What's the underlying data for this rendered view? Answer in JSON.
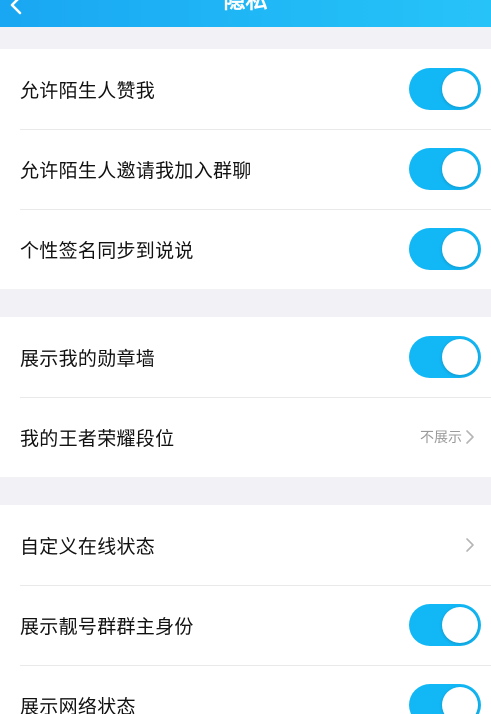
{
  "header": {
    "title": "隐私",
    "accent_color": "#1aaaf3"
  },
  "groups": [
    {
      "rows": [
        {
          "label": "允许陌生人赞我",
          "type": "toggle",
          "on": true
        },
        {
          "label": "允许陌生人邀请我加入群聊",
          "type": "toggle",
          "on": true
        },
        {
          "label": "个性签名同步到说说",
          "type": "toggle",
          "on": true
        }
      ]
    },
    {
      "rows": [
        {
          "label": "展示我的勋章墙",
          "type": "toggle",
          "on": true
        },
        {
          "label": "我的王者荣耀段位",
          "type": "link",
          "value": "不展示"
        }
      ]
    },
    {
      "rows": [
        {
          "label": "自定义在线状态",
          "type": "link",
          "value": ""
        },
        {
          "label": "展示靓号群群主身份",
          "type": "toggle",
          "on": true
        },
        {
          "label": "展示网络状态",
          "type": "toggle",
          "on": true
        }
      ]
    }
  ],
  "colors": {
    "toggle_on": "#12b7f5",
    "background": "#f2f2f6",
    "secondary_text": "#9a9a9a"
  },
  "icons": {
    "back": "chevron-left-icon",
    "row_arrow": "chevron-right-icon"
  }
}
